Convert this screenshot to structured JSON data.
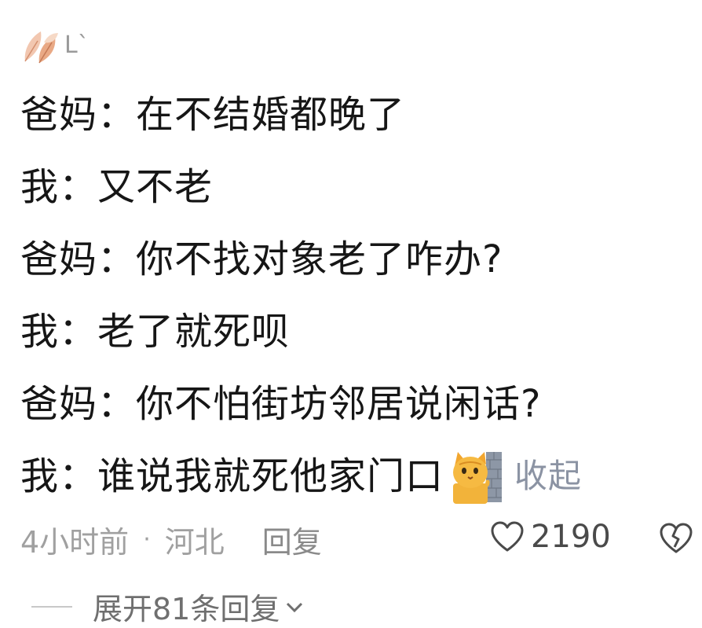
{
  "header": {
    "username": "Lˋ"
  },
  "comment": {
    "lines": [
      "爸妈：在不结婚都晚了",
      "我：又不老",
      "爸妈：你不找对象老了咋办?",
      "我：老了就死呗",
      "爸妈：你不怕街坊邻居说闲话?",
      "我：谁说我就死他家门口"
    ],
    "emoji": "cat-peeking-behind-wall-icon",
    "collapse_label": "收起"
  },
  "meta": {
    "time": "4小时前",
    "separator": "·",
    "location": "河北",
    "reply_label": "回复"
  },
  "actions": {
    "like_count": "2190"
  },
  "replies": {
    "expand_label": "展开81条回复"
  },
  "colors": {
    "text": "#161616",
    "muted": "#a0a0a0",
    "link": "#8b93a3"
  }
}
